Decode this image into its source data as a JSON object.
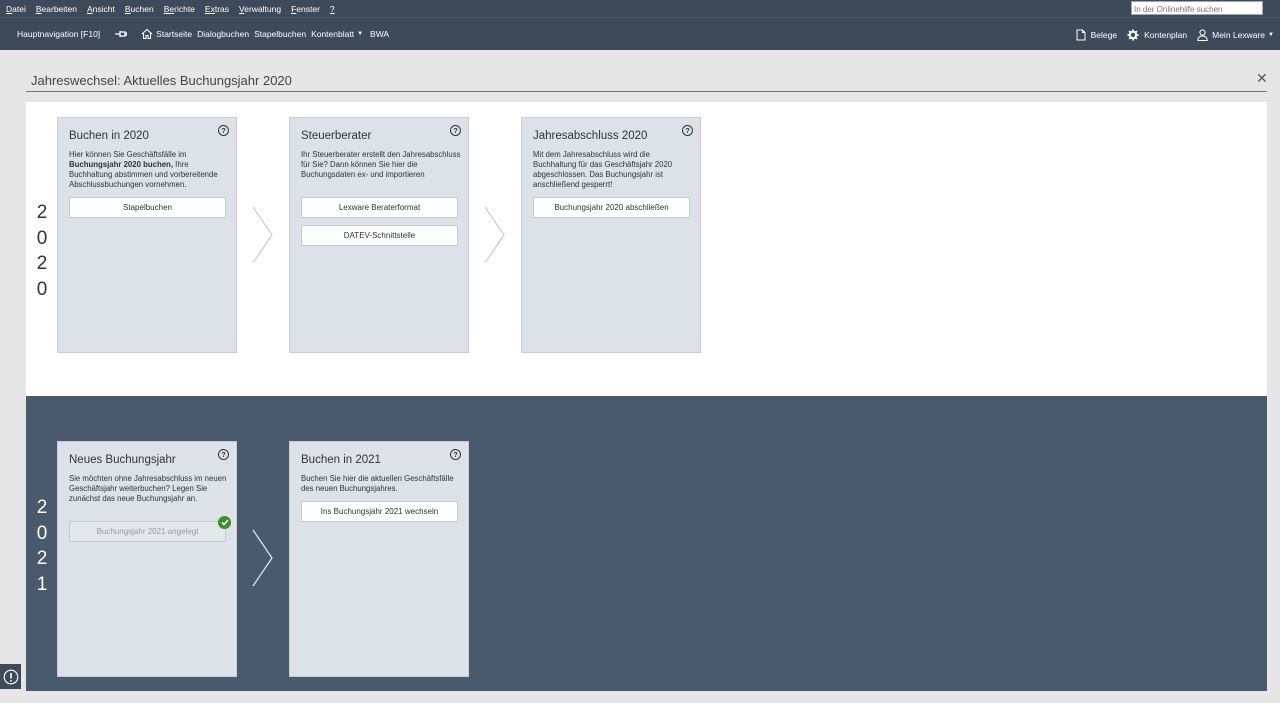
{
  "menu": {
    "items": [
      {
        "label": "Datei",
        "accel": "D",
        "rest": "atei"
      },
      {
        "label": "Bearbeiten",
        "accel": "B",
        "rest": "earbeiten"
      },
      {
        "label": "Ansicht",
        "accel": "A",
        "rest": "nsicht"
      },
      {
        "label": "Buchen",
        "accel": "B",
        "rest": "uchen"
      },
      {
        "label": "Berichte",
        "accel": "Be",
        "rest": "richte"
      },
      {
        "label": "Extras",
        "accel": "Ex",
        "rest": "tras"
      },
      {
        "label": "Verwaltung",
        "accel": "V",
        "rest": "erwaltung"
      },
      {
        "label": "Fenster",
        "accel": "F",
        "rest": "enster"
      },
      {
        "label": "?",
        "accel": "?",
        "rest": ""
      }
    ],
    "search_placeholder": "In der Onlinehilfe suchen"
  },
  "toolbar": {
    "nav_label": "Hauptnavigation [F10]",
    "startseite": "Startseite",
    "dialogbuchen": "Dialogbuchen",
    "stapelbuchen": "Stapelbuchen",
    "kontenblatt": "Kontenblatt",
    "bwa": "BWA",
    "belege": "Belege",
    "kontenplan": "Kontenplan",
    "mein_lexware": "Mein Lexware"
  },
  "page": {
    "title": "Jahreswechsel: Aktuelles Buchungsjahr 2020"
  },
  "section_2020": {
    "year_digits": [
      "2",
      "0",
      "2",
      "0"
    ],
    "cards": [
      {
        "title": "Buchen in 2020",
        "desc_pre": "Hier können Sie Geschäftsfälle im ",
        "desc_bold": "Buchungsjahr 2020 buchen,",
        "desc_post": "  Ihre Buchhaltung abstimmen und vorbereitende Abschlussbuchungen vornehmen.",
        "buttons": [
          "Stapelbuchen"
        ]
      },
      {
        "title": "Steuerberater",
        "desc": "Ihr Steuerberater erstellt den Jahresabschluss für Sie? Dann können Sie hier die Buchungsdaten ex- und importieren",
        "buttons": [
          "Lexware Beraterformat",
          "DATEV-Schnittstelle"
        ]
      },
      {
        "title": "Jahresabschluss 2020",
        "desc": "Mit dem Jahresabschluss wird die Buchhaltung für das Geschäftsjahr 2020 abgeschlossen.  Das Buchungsjahr ist anschließend gesperrt!",
        "buttons": [
          "Buchungsjahr 2020 abschließen"
        ]
      }
    ]
  },
  "section_2021": {
    "year_digits": [
      "2",
      "0",
      "2",
      "1"
    ],
    "cards": [
      {
        "title": "Neues Buchungsjahr",
        "desc": "Sie möchten ohne Jahresabschluss im neuen Geschäftsjahr weiterbuchen?  Legen Sie zunächst das neue Buchungsjahr an.",
        "buttons": [
          "Buchungsjahr 2021 angelegt"
        ]
      },
      {
        "title": "Buchen in 2021",
        "desc": "Buchen Sie hier die aktuellen Geschäftsfälle des neuen Buchungsjahres.",
        "buttons": [
          "Ins Buchungsjahr 2021 wechseln"
        ]
      }
    ]
  },
  "colors": {
    "bar": "#3d4a5a",
    "dark_section": "#4a5a6d",
    "card": "#dde2e9",
    "success": "#3e8e2b"
  },
  "icons": [
    "home-icon",
    "pin-icon",
    "document-icon",
    "gear-icon",
    "user-icon",
    "help-icon",
    "check-icon",
    "warning-icon",
    "close-icon",
    "chevron-right-icon"
  ]
}
